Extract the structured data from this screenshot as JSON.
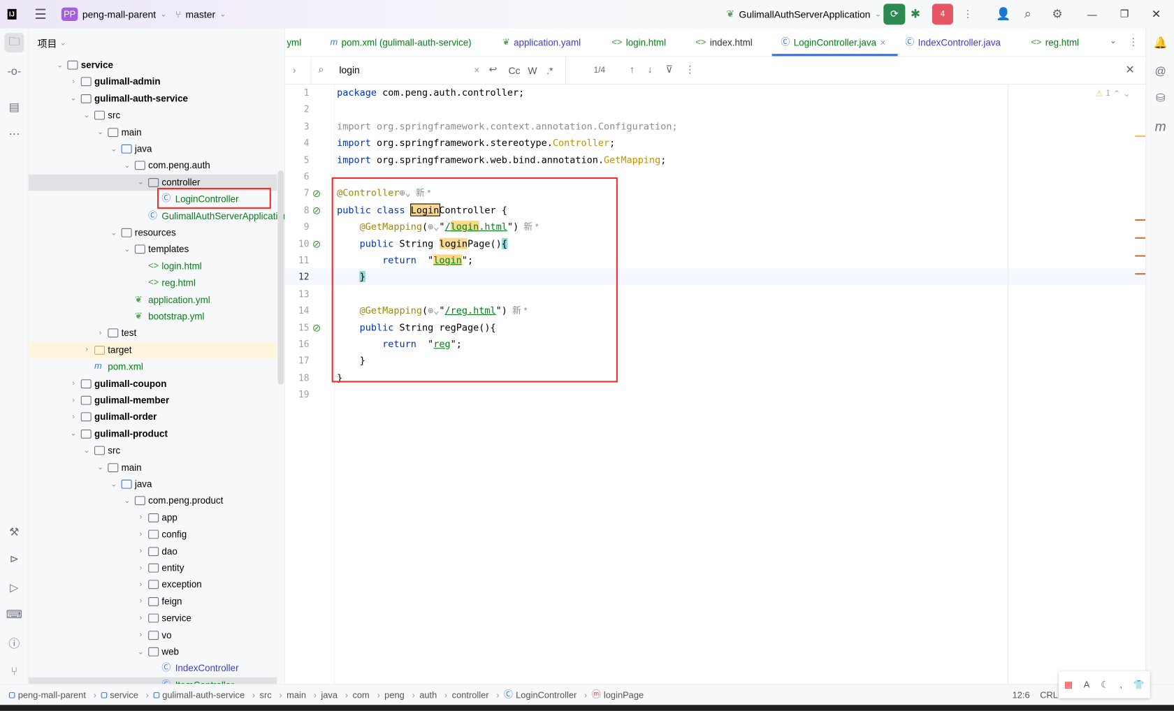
{
  "titlebar": {
    "project_badge": "PP",
    "project": "peng-mall-parent",
    "branch": "master",
    "run_config": "GulimallAuthServerApplication",
    "stop_count": "4"
  },
  "project_panel": {
    "title": "项目",
    "tree": [
      {
        "l": 0,
        "t": "service",
        "exp": true,
        "bold": true,
        "icon": "module"
      },
      {
        "l": 1,
        "t": "gulimall-admin",
        "exp": false,
        "bold": true,
        "icon": "module"
      },
      {
        "l": 1,
        "t": "gulimall-auth-service",
        "exp": true,
        "bold": true,
        "icon": "module"
      },
      {
        "l": 2,
        "t": "src",
        "exp": true,
        "icon": "folder"
      },
      {
        "l": 3,
        "t": "main",
        "exp": true,
        "icon": "folder"
      },
      {
        "l": 4,
        "t": "java",
        "exp": true,
        "icon": "src-folder"
      },
      {
        "l": 5,
        "t": "com.peng.auth",
        "exp": true,
        "icon": "package"
      },
      {
        "l": 6,
        "t": "controller",
        "exp": true,
        "icon": "package",
        "selected": true
      },
      {
        "l": 7,
        "t": "LoginController",
        "icon": "class",
        "color": "#067d17",
        "boxed": true
      },
      {
        "l": 6,
        "t": "GulimallAuthServerApplication",
        "icon": "spring-class",
        "color": "#067d17"
      },
      {
        "l": 4,
        "t": "resources",
        "exp": true,
        "icon": "res-folder"
      },
      {
        "l": 5,
        "t": "templates",
        "exp": true,
        "icon": "folder"
      },
      {
        "l": 6,
        "t": "login.html",
        "icon": "html",
        "color": "#067d17"
      },
      {
        "l": 6,
        "t": "reg.html",
        "icon": "html",
        "color": "#067d17"
      },
      {
        "l": 5,
        "t": "application.yml",
        "icon": "spring",
        "color": "#067d17"
      },
      {
        "l": 5,
        "t": "bootstrap.yml",
        "icon": "spring",
        "color": "#067d17"
      },
      {
        "l": 3,
        "t": "test",
        "exp": false,
        "icon": "folder"
      },
      {
        "l": 2,
        "t": "target",
        "exp": false,
        "icon": "excluded-folder",
        "excluded": true
      },
      {
        "l": 2,
        "t": "pom.xml",
        "icon": "maven",
        "color": "#067d17"
      },
      {
        "l": 1,
        "t": "gulimall-coupon",
        "exp": false,
        "bold": true,
        "icon": "module"
      },
      {
        "l": 1,
        "t": "gulimall-member",
        "exp": false,
        "bold": true,
        "icon": "module"
      },
      {
        "l": 1,
        "t": "gulimall-order",
        "exp": false,
        "bold": true,
        "icon": "module"
      },
      {
        "l": 1,
        "t": "gulimall-product",
        "exp": true,
        "bold": true,
        "icon": "module"
      },
      {
        "l": 2,
        "t": "src",
        "exp": true,
        "icon": "folder"
      },
      {
        "l": 3,
        "t": "main",
        "exp": true,
        "icon": "folder"
      },
      {
        "l": 4,
        "t": "java",
        "exp": true,
        "icon": "src-folder"
      },
      {
        "l": 5,
        "t": "com.peng.product",
        "exp": true,
        "icon": "package"
      },
      {
        "l": 6,
        "t": "app",
        "exp": false,
        "icon": "package"
      },
      {
        "l": 6,
        "t": "config",
        "exp": false,
        "icon": "package"
      },
      {
        "l": 6,
        "t": "dao",
        "exp": false,
        "icon": "package"
      },
      {
        "l": 6,
        "t": "entity",
        "exp": false,
        "icon": "package"
      },
      {
        "l": 6,
        "t": "exception",
        "exp": false,
        "icon": "package"
      },
      {
        "l": 6,
        "t": "feign",
        "exp": false,
        "icon": "package"
      },
      {
        "l": 6,
        "t": "service",
        "exp": false,
        "icon": "package"
      },
      {
        "l": 6,
        "t": "vo",
        "exp": false,
        "icon": "package"
      },
      {
        "l": 6,
        "t": "web",
        "exp": true,
        "icon": "package"
      },
      {
        "l": 7,
        "t": "IndexController",
        "icon": "class",
        "color": "#3d3dc7"
      },
      {
        "l": 7,
        "t": "ItemController",
        "icon": "class",
        "color": "#067d17",
        "selected": true
      }
    ]
  },
  "tabs": [
    {
      "label": "yml",
      "icon": "",
      "color": "#067d17"
    },
    {
      "label": "pom.xml (gulimall-auth-service)",
      "icon": "maven",
      "color": "#067d17"
    },
    {
      "label": "application.yaml",
      "icon": "spring",
      "color": "#3d3dc7"
    },
    {
      "label": "login.html",
      "icon": "html",
      "color": "#067d17"
    },
    {
      "label": "index.html",
      "icon": "html",
      "color": "#333333"
    },
    {
      "label": "LoginController.java",
      "icon": "class",
      "color": "#067d17",
      "active": true
    },
    {
      "label": "IndexController.java",
      "icon": "class",
      "color": "#3d3dc7"
    },
    {
      "label": "reg.html",
      "icon": "html",
      "color": "#067d17"
    }
  ],
  "find": {
    "query": "login",
    "match_case": "Cc",
    "words": "W",
    "regex": ".*",
    "count": "1/4"
  },
  "editor": {
    "warnings": "1",
    "current_line": 12,
    "lines": [
      [
        [
          "package",
          "kw"
        ],
        [
          " com.peng.auth.controller;",
          ""
        ]
      ],
      [],
      [
        [
          "import org.springframework.context.annotation.Configuration;",
          "gray"
        ]
      ],
      [
        [
          "import",
          "kw"
        ],
        [
          " org.springframework.stereotype.",
          ""
        ],
        [
          "Controller",
          "cls"
        ],
        [
          ";",
          ""
        ]
      ],
      [
        [
          "import",
          "kw"
        ],
        [
          " org.springframework.web.bind.annotation.",
          ""
        ],
        [
          "GetMapping",
          "cls"
        ],
        [
          ";",
          ""
        ]
      ],
      [],
      [
        [
          "@Controller",
          "ann"
        ],
        [
          "⊕⌄",
          "gray"
        ],
        [
          "  新 *",
          "hint"
        ]
      ],
      [
        [
          "public class ",
          "kw"
        ],
        [
          "Login",
          "hlb"
        ],
        [
          "Controller {",
          ""
        ]
      ],
      [
        [
          "    ",
          ""
        ],
        [
          "@GetMapping",
          "ann"
        ],
        [
          "(",
          ""
        ],
        [
          "⊕⌄",
          "gray"
        ],
        [
          "\"",
          ""
        ],
        [
          "/",
          "str ul"
        ],
        [
          "login",
          "str ul hl"
        ],
        [
          ".html",
          "str ul"
        ],
        [
          "\")",
          ""
        ],
        [
          "  新 *",
          "hint"
        ]
      ],
      [
        [
          "    ",
          ""
        ],
        [
          "public ",
          "kw"
        ],
        [
          "String ",
          ""
        ],
        [
          "login",
          "hl"
        ],
        [
          "Page()",
          ""
        ],
        [
          "{",
          "brace"
        ]
      ],
      [
        [
          "        ",
          ""
        ],
        [
          "return ",
          "kw"
        ],
        [
          " \"",
          ""
        ],
        [
          "login",
          "str ul hl"
        ],
        [
          "\";",
          ""
        ]
      ],
      [
        [
          "    ",
          ""
        ],
        [
          "}",
          "brace"
        ]
      ],
      [],
      [
        [
          "    ",
          ""
        ],
        [
          "@GetMapping",
          "ann"
        ],
        [
          "(",
          ""
        ],
        [
          "⊕⌄",
          "gray"
        ],
        [
          "\"",
          ""
        ],
        [
          "/reg.html",
          "str ul"
        ],
        [
          "\")",
          ""
        ],
        [
          "  新 *",
          "hint"
        ]
      ],
      [
        [
          "    ",
          ""
        ],
        [
          "public ",
          "kw"
        ],
        [
          "String regPage(){",
          ""
        ]
      ],
      [
        [
          "        ",
          ""
        ],
        [
          "return ",
          "kw"
        ],
        [
          " \"",
          ""
        ],
        [
          "reg",
          "str ul"
        ],
        [
          "\";",
          ""
        ]
      ],
      [
        [
          "    }",
          ""
        ]
      ],
      [
        [
          "}",
          ""
        ]
      ],
      []
    ]
  },
  "status": {
    "breadcrumbs": [
      {
        "t": "peng-mall-parent",
        "icon": "module"
      },
      {
        "t": "service",
        "icon": "module"
      },
      {
        "t": "gulimall-auth-service",
        "icon": "module"
      },
      {
        "t": "src"
      },
      {
        "t": "main"
      },
      {
        "t": "java"
      },
      {
        "t": "com"
      },
      {
        "t": "peng"
      },
      {
        "t": "auth"
      },
      {
        "t": "controller"
      },
      {
        "t": "LoginController",
        "icon": "class"
      },
      {
        "t": "loginPage",
        "icon": "method"
      }
    ],
    "position": "12:6",
    "line_sep": "CRLF"
  },
  "colors": {
    "accent": "#3574f0",
    "run_green": "#2d8a4e",
    "stop_red": "#e55765",
    "highlight_box": "#f03030"
  }
}
